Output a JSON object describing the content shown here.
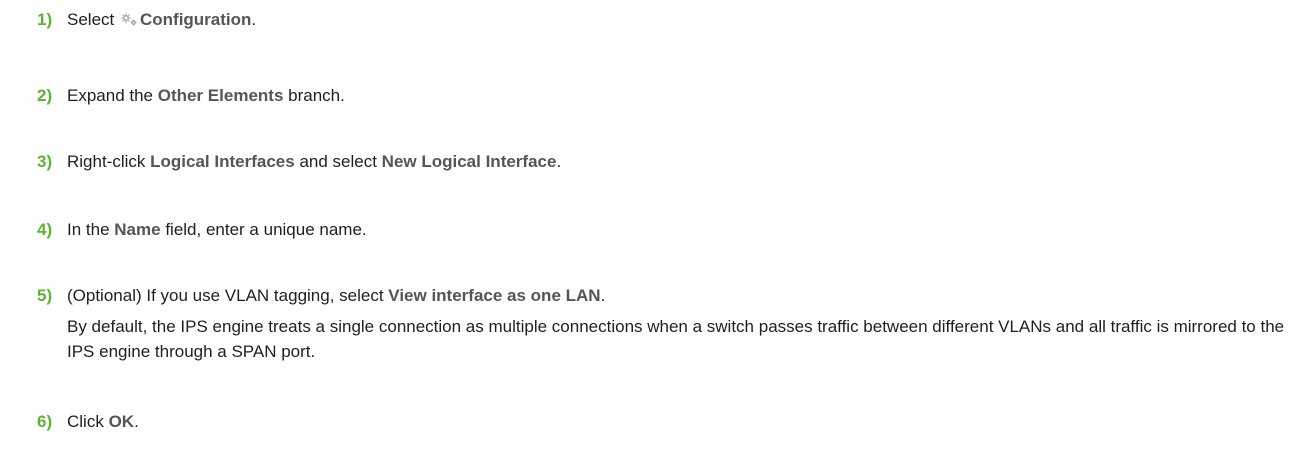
{
  "steps": [
    {
      "number": "1)",
      "parts": {
        "t1": "Select",
        "b1": "Configuration",
        "t2": "."
      },
      "icon": "gear-icon"
    },
    {
      "number": "2)",
      "parts": {
        "t1": "Expand the",
        "b1": "Other Elements",
        "t2": "branch."
      }
    },
    {
      "number": "3)",
      "parts": {
        "t1": "Right-click",
        "b1": "Logical Interfaces",
        "t2": "and select",
        "b2": "New Logical Interface",
        "t3": "."
      }
    },
    {
      "number": "4)",
      "parts": {
        "t1": "In the",
        "b1": "Name",
        "t2": "field, enter a unique name."
      }
    },
    {
      "number": "5)",
      "parts": {
        "t1": "(Optional) If you use VLAN tagging, select",
        "b1": "View interface as one LAN",
        "t2": "."
      },
      "note": "By default, the IPS engine treats a single connection as multiple connections when a switch passes traffic between different VLANs and all traffic is mirrored to the IPS engine through a SPAN port."
    },
    {
      "number": "6)",
      "parts": {
        "t1": "Click",
        "b1": "OK",
        "t2": "."
      }
    }
  ],
  "colors": {
    "step_number": "#5cb531",
    "ui_term": "#555555",
    "text": "#1f1f1f",
    "icon": "#9a9a9a"
  }
}
